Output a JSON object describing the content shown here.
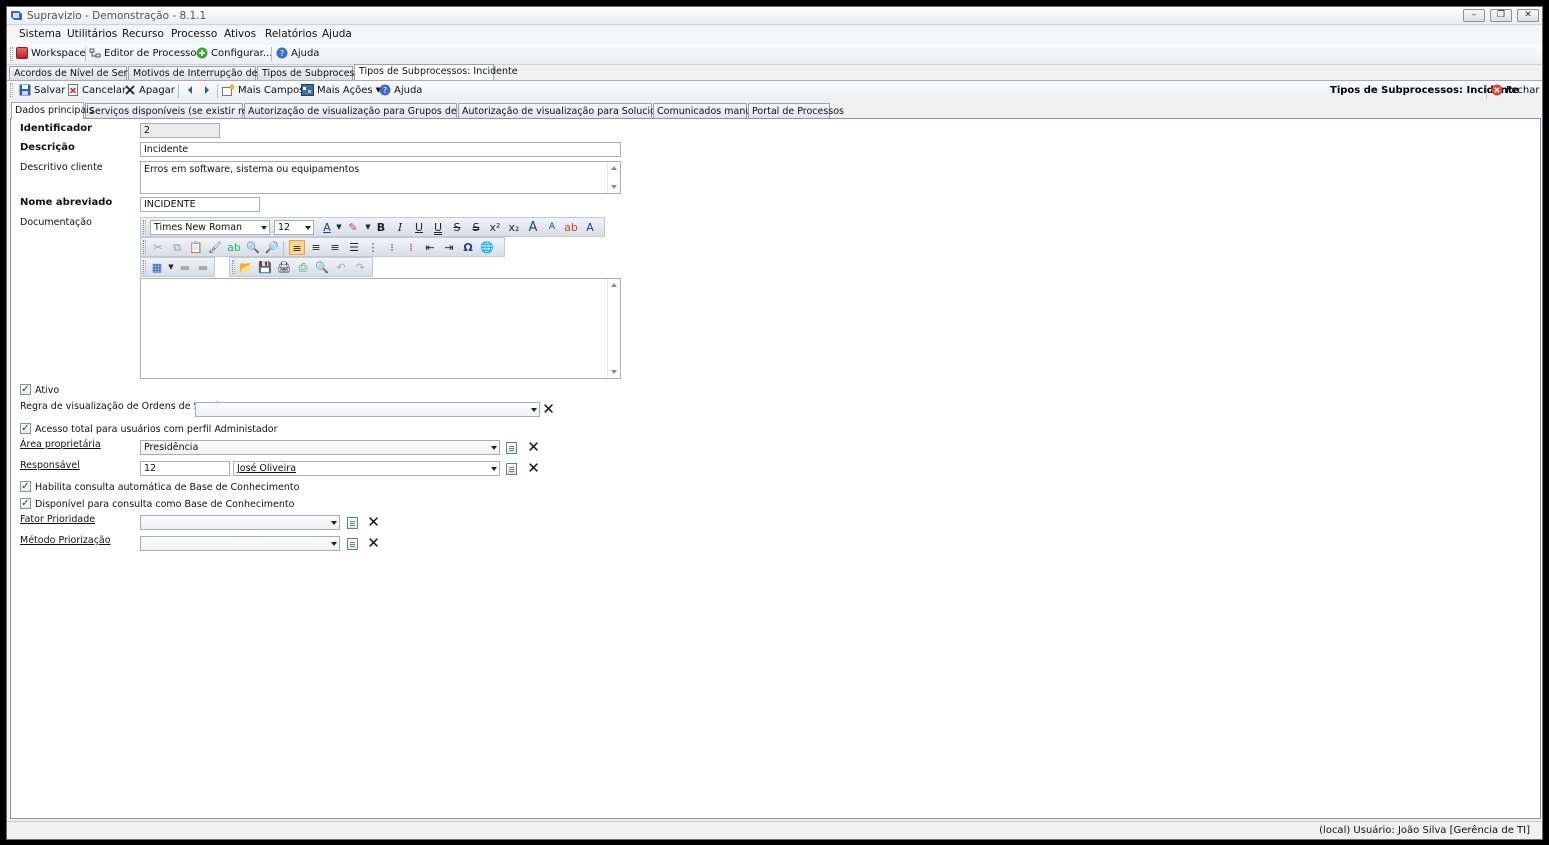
{
  "window": {
    "title": "Supravizio - Demonstração - 8.1.1",
    "minimize": "–",
    "restore": "❐",
    "close": "✕"
  },
  "menu": [
    "Sistema",
    "Utilitários",
    "Recurso",
    "Processo",
    "Ativos",
    "Relatórios",
    "Ajuda"
  ],
  "toolbar_main": {
    "workspace": "Workspace",
    "process_editor": "Editor de Processos",
    "configure": "Configurar...",
    "help": "Ajuda"
  },
  "doc_tabs": [
    "Acordos de Nível de Serviço",
    "Motivos de Interrupção de ANS",
    "Tipos de Subprocessos",
    "Tipos de Subprocessos: Incidente"
  ],
  "toolbar_record": {
    "save": "Salvar",
    "cancel": "Cancelar",
    "delete": "Apagar",
    "more_fields": "Mais Campos",
    "more_actions": "Mais Ações",
    "help": "Ajuda",
    "heading": "Tipos de Subprocessos: Incidente",
    "close": "Fechar"
  },
  "form_tabs": [
    "Dados principais",
    "Serviços disponíveis (se existir restrição)",
    "Autorização de visualização para Grupos de Trabalho",
    "Autorização de visualização para Solucionadores",
    "Comunicados manuais",
    "Portal de Processos"
  ],
  "form": {
    "identificador": {
      "label": "Identificador",
      "value": "2"
    },
    "descricao": {
      "label": "Descrição",
      "value": "Incidente"
    },
    "descritivo_cliente": {
      "label": "Descritivo cliente",
      "value": "Erros em software, sistema ou equipamentos"
    },
    "nome_abreviado": {
      "label": "Nome abreviado",
      "value": "INCIDENTE"
    },
    "documentacao": {
      "label": "Documentação",
      "font": "Times New Roman",
      "size": "12",
      "text": ""
    },
    "ativo": {
      "label": "Ativo",
      "checked": true
    },
    "regra_visualizacao": {
      "label": "Regra de visualização de Ordens de Serviço",
      "value": ""
    },
    "acesso_total": {
      "label": "Acesso total para usuários com perfil Administador",
      "checked": true
    },
    "area_proprietaria": {
      "label": "Área proprietária",
      "value": "Presidência"
    },
    "responsavel": {
      "label": "Responsável",
      "code": "12",
      "name": "José Oliveira"
    },
    "habilita_consulta": {
      "label": "Habilita consulta automática de Base de Conhecimento",
      "checked": true
    },
    "disponivel_consulta": {
      "label": "Disponível para consulta como Base de Conhecimento",
      "checked": true
    },
    "fator_prioridade": {
      "label": "Fator Prioridade",
      "value": ""
    },
    "metodo_priorizacao": {
      "label": "Método Priorização",
      "value": ""
    }
  },
  "status": "(local)  Usuário: João Silva [Gerência de TI]",
  "colors": {
    "active_align": "#ffd58a",
    "window_bg": "#f0f0f0",
    "panel_bg": "#ffffff"
  }
}
